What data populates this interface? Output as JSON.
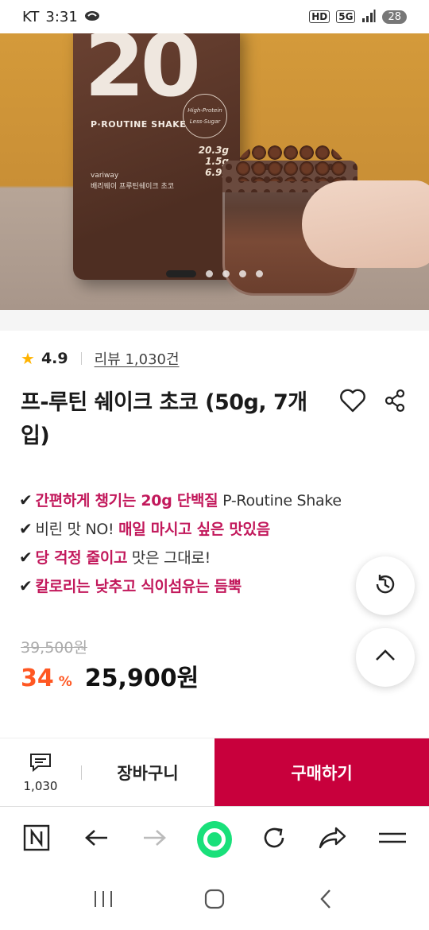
{
  "status_bar": {
    "carrier": "KT",
    "time": "3:31",
    "indicators": [
      "HD",
      "5G"
    ],
    "battery": "28"
  },
  "hero": {
    "package_number": "20",
    "package_brand_line": "P·ROUTINE SHAKE",
    "package_badge": [
      "High-Protein",
      "Less-Sugar"
    ],
    "package_maker": "variway",
    "package_product_name": "배리웨이 프루틴쉐이크 초코",
    "package_nutrition": [
      "20.3g",
      "1.5g",
      "6.9g"
    ],
    "carousel_total": 5,
    "carousel_index": 1
  },
  "product": {
    "rating": "4.9",
    "review_label": "리뷰 1,030건",
    "title": "프-루틴 쉐이크 초코 (50g, 7개입)",
    "features": [
      {
        "check": "✔",
        "hl1": "간편하게 챙기는 20g 단백질",
        "text": " P-Routine Shake",
        "hl2": ""
      },
      {
        "check": "✔",
        "hl1": "",
        "text": "비린 맛 NO! ",
        "hl2": "매일 마시고 싶은 맛있음"
      },
      {
        "check": "✔",
        "hl1": "당 걱정 줄이고",
        "text": " 맛은 그대로!",
        "hl2": ""
      },
      {
        "check": "✔",
        "hl1": "칼로리는 낮추고 식이섬유는 듬뿍",
        "text": "",
        "hl2": ""
      }
    ],
    "original_price": "39,500원",
    "discount": "34",
    "discount_unit": "%",
    "sale_price": "25,900원"
  },
  "purchase_bar": {
    "review_count": "1,030",
    "cart_label": "장바구니",
    "buy_label": "구매하기"
  },
  "icons": {
    "star": "star-icon",
    "heart": "heart-icon",
    "share": "share-icon",
    "history": "history-icon",
    "scroll_top": "chevron-up-icon",
    "comment": "comment-icon"
  },
  "colors": {
    "accent": "#c8003c",
    "highlight": "#c2185b",
    "discount": "#ff5722",
    "naver_green": "#19e07a"
  }
}
